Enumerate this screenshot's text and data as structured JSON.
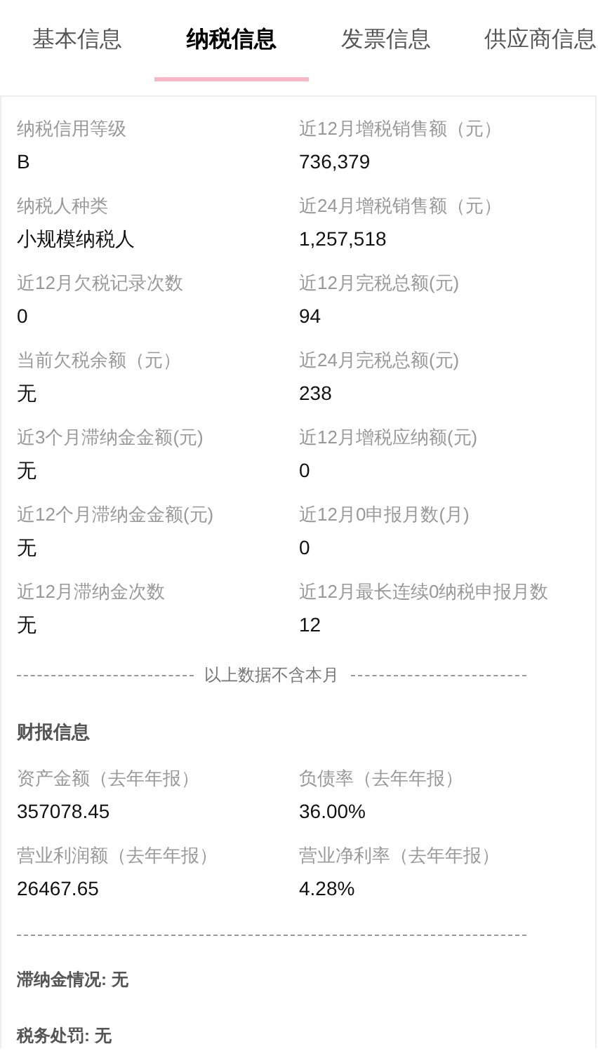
{
  "tabs": [
    {
      "label": "基本信息",
      "selected": false
    },
    {
      "label": "纳税信息",
      "selected": true
    },
    {
      "label": "发票信息",
      "selected": false
    },
    {
      "label": "供应商信息",
      "selected": false
    }
  ],
  "tax_fields": [
    {
      "label": "纳税信用等级",
      "value": "B"
    },
    {
      "label": "近12月增税销售额（元）",
      "value": "736,379"
    },
    {
      "label": "纳税人种类",
      "value": "小规模纳税人"
    },
    {
      "label": "近24月增税销售额（元）",
      "value": "1,257,518"
    },
    {
      "label": "近12月欠税记录次数",
      "value": "0"
    },
    {
      "label": "近12月完税总额(元)",
      "value": "94"
    },
    {
      "label": "当前欠税余额（元）",
      "value": "无"
    },
    {
      "label": "近24月完税总额(元)",
      "value": "238"
    },
    {
      "label": "近3个月滞纳金金额(元)",
      "value": "无"
    },
    {
      "label": "近12月增税应纳额(元)",
      "value": "0"
    },
    {
      "label": "近12个月滞纳金金额(元)",
      "value": "无"
    },
    {
      "label": "近12月0申报月数(月)",
      "value": "0"
    },
    {
      "label": "近12月滞纳金次数",
      "value": "无"
    },
    {
      "label": "近12月最长连续0纳税申报月数",
      "value": "12"
    }
  ],
  "note": "以上数据不含本月",
  "financial_section": {
    "title": "财报信息",
    "fields": [
      {
        "label": "资产金额（去年年报）",
        "value": "357078.45"
      },
      {
        "label": "负债率（去年年报）",
        "value": "36.00%"
      },
      {
        "label": "营业利润额（去年年报）",
        "value": "26467.65"
      },
      {
        "label": "营业净利率（去年年报）",
        "value": "4.28%"
      }
    ]
  },
  "summary_lines": [
    "滞纳金情况: 无",
    "税务处罚: 无"
  ]
}
